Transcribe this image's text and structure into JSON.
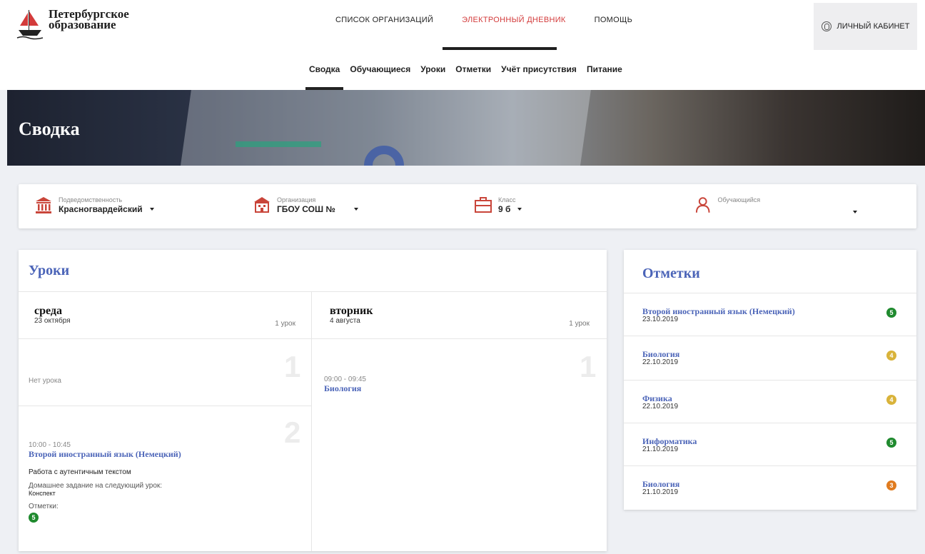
{
  "header": {
    "logo_line1": "Петербургское",
    "logo_line2": "образование",
    "nav": [
      {
        "label": "СПИСОК ОРГАНИЗАЦИЙ",
        "active": false
      },
      {
        "label": "ЭЛЕКТРОННЫЙ ДНЕВНИК",
        "active": true
      },
      {
        "label": "ПОМОЩЬ",
        "active": false
      }
    ],
    "account_label": "ЛИЧНЫЙ КАБИНЕТ",
    "account_icon": "user-circle-icon"
  },
  "subnav": [
    {
      "label": "Сводка",
      "active": true
    },
    {
      "label": "Обучающиеся",
      "active": false
    },
    {
      "label": "Уроки",
      "active": false
    },
    {
      "label": "Отметки",
      "active": false
    },
    {
      "label": "Учёт присутствия",
      "active": false
    },
    {
      "label": "Питание",
      "active": false
    }
  ],
  "banner": {
    "title": "Сводка"
  },
  "filters": [
    {
      "label": "Подведомственность",
      "value": "Красногвардейский",
      "icon": "institution-icon"
    },
    {
      "label": "Организация",
      "value": "ГБОУ СОШ №",
      "icon": "school-icon"
    },
    {
      "label": "Класс",
      "value": "9 б",
      "icon": "briefcase-icon"
    },
    {
      "label": "Обучающийся",
      "value": "",
      "icon": "student-icon"
    }
  ],
  "lessons": {
    "title": "Уроки",
    "days": [
      {
        "name": "среда",
        "date": "23 октября",
        "count": "1 урок",
        "slots": [
          {
            "number": "1",
            "empty_text": "Нет урока"
          },
          {
            "number": "2",
            "time": "10:00 - 10:45",
            "subject": "Второй иностранный язык (Немецкий)",
            "topic": "Работа с аутентичным текстом",
            "homework_label": "Домашнее задание на следующий урок:",
            "homework": "Конспект",
            "marks_label": "Отметки:",
            "mark": "5"
          }
        ]
      },
      {
        "name": "вторник",
        "date": "4 августа",
        "count": "1 урок",
        "slots": [
          {
            "number": "1",
            "time": "09:00 - 09:45",
            "subject": "Биология"
          }
        ]
      }
    ]
  },
  "marks": {
    "title": "Отметки",
    "items": [
      {
        "subject": "Второй иностранный язык (Немецкий)",
        "date": "23.10.2019",
        "mark": "5",
        "color": "#1f8a2e"
      },
      {
        "subject": "Биология",
        "date": "22.10.2019",
        "mark": "4",
        "color": "#d9b33a"
      },
      {
        "subject": "Физика",
        "date": "22.10.2019",
        "mark": "4",
        "color": "#d9b33a"
      },
      {
        "subject": "Информатика",
        "date": "21.10.2019",
        "mark": "5",
        "color": "#1f8a2e"
      },
      {
        "subject": "Биология",
        "date": "21.10.2019",
        "mark": "3",
        "color": "#e07b1f"
      }
    ]
  },
  "colors": {
    "accent": "#4b64b8",
    "active_nav": "#d33b3b"
  }
}
